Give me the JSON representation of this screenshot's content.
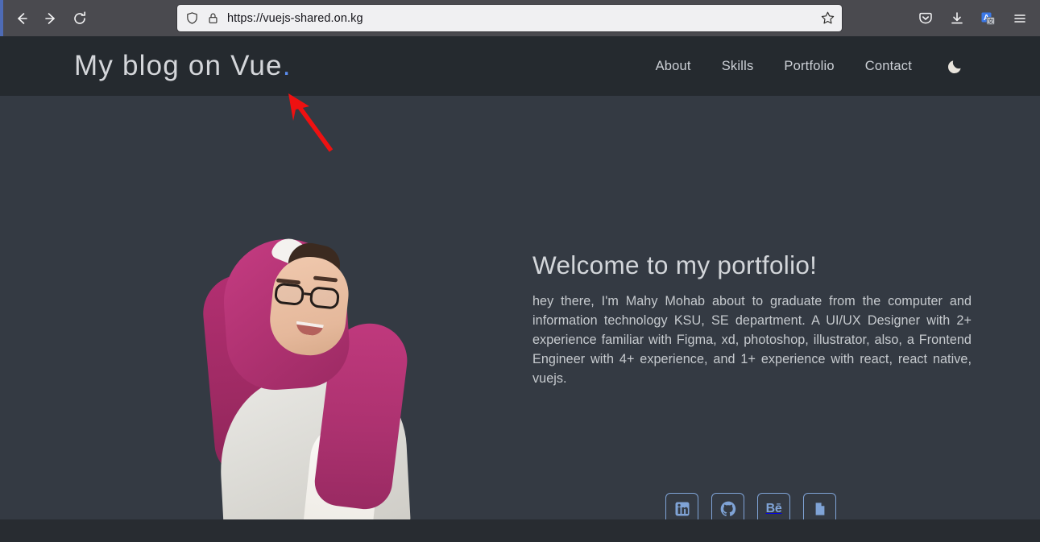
{
  "browser": {
    "back_icon": "back-arrow-icon",
    "forward_icon": "forward-arrow-icon",
    "reload_icon": "reload-icon",
    "shield_icon": "shield-icon",
    "lock_icon": "padlock-icon",
    "url": "https://vuejs-shared.on.kg",
    "bookmark_icon": "star-icon",
    "pocket_icon": "pocket-icon",
    "download_icon": "download-icon",
    "translate_icon": "translate-icon",
    "menu_icon": "hamburger-menu-icon"
  },
  "site": {
    "logo_text": "My blog on Vue",
    "logo_dot": ".",
    "accent_color": "#5b8def",
    "header_bg": "#252a2f",
    "hero_bg": "#343a43",
    "nav": [
      {
        "label": "About"
      },
      {
        "label": "Skills"
      },
      {
        "label": "Portfolio"
      },
      {
        "label": "Contact"
      }
    ],
    "theme_toggle_icon": "moon-icon"
  },
  "hero": {
    "title": "Welcome to my portfolio!",
    "paragraph": "hey there, I'm Mahy Mohab about to graduate from the computer and information technology KSU, SE department. A UI/UX Designer with 2+ experience familiar with Figma, xd, photoshop, illustrator, also, a Frontend Engineer with 4+ experience, and 1+ experience with react, react native, vuejs.",
    "portrait_alt": "portrait-photo",
    "social": [
      {
        "name": "linkedin",
        "icon": "linkedin-icon",
        "label": "in"
      },
      {
        "name": "github",
        "icon": "github-icon",
        "label": ""
      },
      {
        "name": "behance",
        "icon": "behance-icon",
        "label": "Bē"
      },
      {
        "name": "resume",
        "icon": "document-icon",
        "label": ""
      }
    ],
    "social_color": "#7fa3d6"
  },
  "annotation": {
    "arrow_color": "#ee1111",
    "name": "red-annotation-arrow"
  }
}
